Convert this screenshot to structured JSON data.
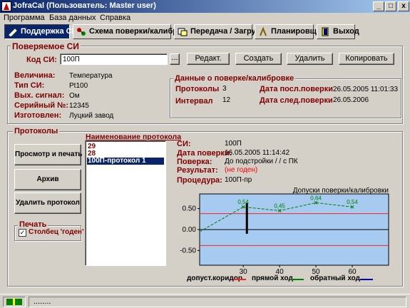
{
  "window": {
    "title": "JofraCal (Пользователь: Master user)",
    "minimize": "_",
    "maximize": "□",
    "close": "x"
  },
  "menu": [
    "Программа",
    "База данных",
    "Справка"
  ],
  "toolbar": {
    "support": "Поддержка СИ",
    "scheme": "Схема поверки/калибровки",
    "transfer": "Передача / Загрузка",
    "planner": "Планировщик",
    "exit": "Выход"
  },
  "device_group": {
    "title": "Поверяемое СИ",
    "code_label": "Код СИ:",
    "code_value": "100П",
    "browse": "...",
    "edit": "Редакт.",
    "create": "Создать",
    "delete": "Удалить",
    "copy": "Копировать"
  },
  "device_info": {
    "quantity_label": "Величина:",
    "quantity": "Температура",
    "type_label": "Тип СИ:",
    "type": "Pt100",
    "output_label": "Вых. сигнал:",
    "output": "Ом",
    "serial_label": "Серийный №:",
    "serial": "12345",
    "maker_label": "Изготовлен:",
    "maker": "Луцкий завод"
  },
  "calib_info": {
    "title": "Данные о поверке/калибровке",
    "protocols_label": "Протоколы",
    "protocols": "3",
    "interval_label": "Интервал",
    "interval": "12",
    "last_label": "Дата посл.поверки",
    "last": "26.05.2005 11:01:33",
    "next_label": "Дата след.поверки",
    "next": "26.05.2006"
  },
  "protocols": {
    "title": "Протоколы",
    "list_header": "Наименование протокола",
    "items": [
      "29",
      "28",
      "100П-протокол 1"
    ],
    "selected_index": 2,
    "view_print": "Просмотр и печать",
    "archive": "Архив",
    "delete": "Удалить протокол",
    "print_title": "Печать",
    "print_column": "Столбец 'годен'",
    "print_column_checked": true
  },
  "protocol_details": {
    "si_label": "СИ:",
    "si": "100П",
    "date_label": "Дата поверки:",
    "date": "16.05.2005 11:14:42",
    "check_label": "Поверка:",
    "check": "До подстройки / / с ПК",
    "result_label": "Результат:",
    "result": "(не годен)",
    "procedure_label": "Процедура:",
    "procedure": "100П-пр"
  },
  "chart_data": {
    "type": "line",
    "title": "Допуски поверки/калибровки",
    "xlim": [
      18,
      70
    ],
    "ylim": [
      -0.85,
      0.85
    ],
    "xticks": [
      30,
      40,
      50,
      60
    ],
    "yticks": [
      0.5,
      0.0,
      -0.5
    ],
    "ytick_labels": [
      "0.50",
      "0.00",
      "-0.50"
    ],
    "series": [
      {
        "name": "допуст.коридор",
        "color": "#ff2020",
        "x": [
          18,
          70
        ],
        "y": [
          0.38,
          0.38
        ]
      },
      {
        "name": "допуст.коридор",
        "color": "#ff2020",
        "x": [
          18,
          70
        ],
        "y": [
          -0.38,
          -0.38
        ]
      },
      {
        "name": "прямой ход",
        "color": "#008000",
        "x": [
          18,
          30,
          40,
          50,
          60
        ],
        "y": [
          -0.05,
          0.54,
          0.45,
          0.64,
          0.54
        ]
      },
      {
        "name": "обратный ход",
        "color": "#0000c0",
        "x": [],
        "y": []
      }
    ],
    "point_labels": [
      {
        "x": 30,
        "y": 0.54,
        "text": "0,54"
      },
      {
        "x": 40,
        "y": 0.45,
        "text": "0,45"
      },
      {
        "x": 50,
        "y": 0.64,
        "text": "0,64"
      },
      {
        "x": 60,
        "y": 0.54,
        "text": "0,54"
      }
    ],
    "marker_bar": {
      "x": 31,
      "y0": -0.1,
      "y1": 0.63
    },
    "background": "#a6caf0"
  },
  "legend": {
    "corridor": "допуст.коридор",
    "forward": "прямой ход",
    "reverse": "обратный ход",
    "corridor_color": "#ff2020",
    "forward_color": "#008000",
    "reverse_color": "#0000c0"
  },
  "statusbar": {
    "text": "........"
  }
}
